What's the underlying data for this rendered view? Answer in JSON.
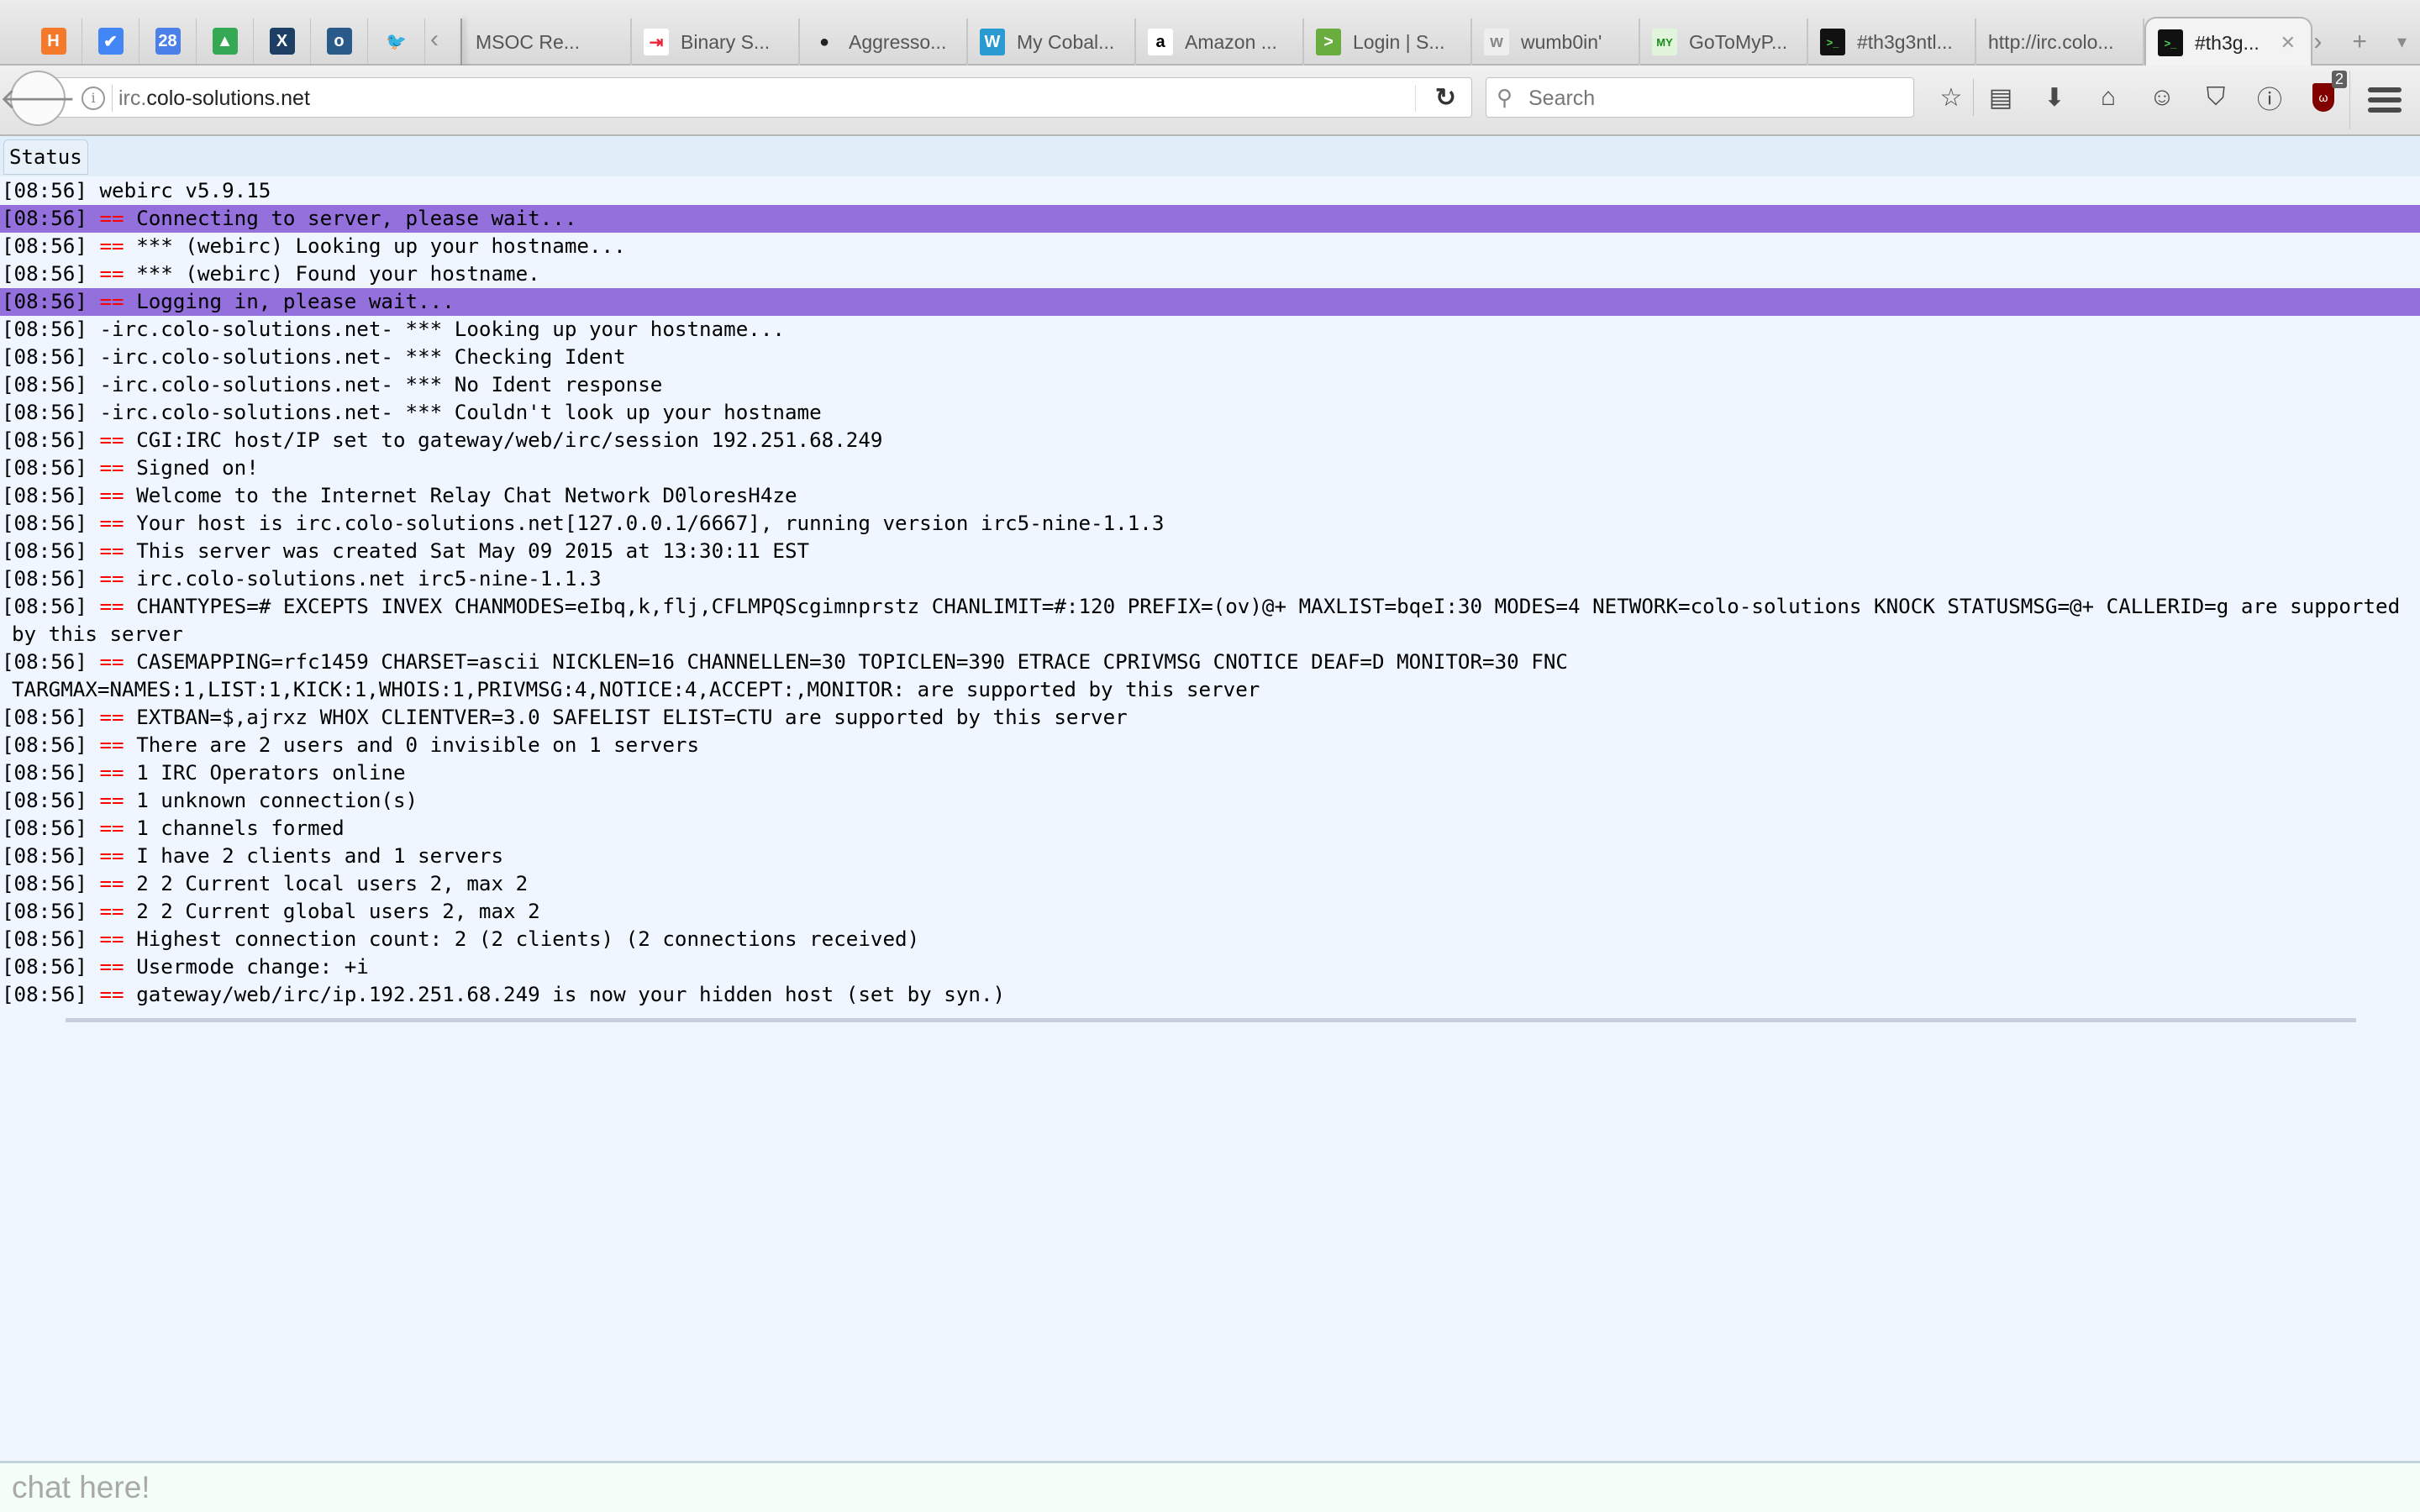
{
  "browser": {
    "pinned_tabs": [
      {
        "icon": "harvest-icon",
        "glyph": "H",
        "color": "#f5792a"
      },
      {
        "icon": "inbox-icon",
        "glyph": "✔",
        "color": "#4285f4"
      },
      {
        "icon": "google-calendar-icon",
        "glyph": "28",
        "color": "#4a80e8"
      },
      {
        "icon": "google-drive-icon",
        "glyph": "▲",
        "color": "#34a853"
      },
      {
        "icon": "jira-icon",
        "glyph": "X",
        "color": "#1d3f66"
      },
      {
        "icon": "trash-bucket-icon",
        "glyph": "o",
        "color": "#2a5a8a"
      },
      {
        "icon": "twitter-icon",
        "glyph": "🐦",
        "color": "#55acee"
      }
    ],
    "tabs": [
      {
        "label": "MSOC Re...",
        "icon": "none",
        "fav_glyph": "",
        "fav_bg": "transparent",
        "fav_color": "#000"
      },
      {
        "label": "Binary S...",
        "icon": "binary-icon",
        "fav_glyph": "⇥",
        "fav_bg": "#ffffff",
        "fav_color": "#e8253a"
      },
      {
        "label": "Aggresso...",
        "icon": "github-icon",
        "fav_glyph": "●",
        "fav_bg": "transparent",
        "fav_color": "#222"
      },
      {
        "label": "My Cobal...",
        "icon": "wordpress-icon",
        "fav_glyph": "W",
        "fav_bg": "#2a9ad3",
        "fav_color": "#fff"
      },
      {
        "label": "Amazon ...",
        "icon": "amazon-icon",
        "fav_glyph": "a",
        "fav_bg": "#ffffff",
        "fav_color": "#000"
      },
      {
        "label": "Login | S...",
        "icon": "login-terminal-icon",
        "fav_glyph": ">",
        "fav_bg": "#69ad3e",
        "fav_color": "#fff"
      },
      {
        "label": "wumb0in'",
        "icon": "keycap-icon",
        "fav_glyph": "w",
        "fav_bg": "#eeeeee",
        "fav_color": "#888"
      },
      {
        "label": "GoToMyP...",
        "icon": "gotomypc-icon",
        "fav_glyph": "MY",
        "fav_bg": "#e2f5dc",
        "fav_color": "#1a8c1a"
      },
      {
        "label": "#th3g3ntl...",
        "icon": "terminal-icon",
        "fav_glyph": ">_",
        "fav_bg": "#111",
        "fav_color": "#4ed24e"
      },
      {
        "label": "http://irc.colo...",
        "icon": "none",
        "fav_glyph": "",
        "fav_bg": "transparent",
        "fav_color": "#000"
      },
      {
        "label": "#th3g...",
        "icon": "terminal-icon",
        "fav_glyph": ">_",
        "fav_bg": "#111",
        "fav_color": "#4ed24e",
        "active": true
      }
    ],
    "tab_close_glyph": "✕",
    "scroll_right_glyph": "›",
    "new_tab_glyph": "+",
    "tab_list_glyph": "▾",
    "scroll_left_glyph": "‹",
    "url_dim": "irc.",
    "url_main": "colo-solutions.net",
    "search_placeholder": "Search",
    "addon_badge": "2"
  },
  "status_tab": "Status",
  "log": [
    {
      "ts": "[08:56]",
      "sep": "",
      "text": "webirc v5.9.15",
      "highlight": false
    },
    {
      "ts": "[08:56]",
      "sep": "==",
      "text": "Connecting to server, please wait...",
      "highlight": true
    },
    {
      "ts": "[08:56]",
      "sep": "==",
      "text": "*** (webirc) Looking up your hostname...",
      "highlight": false
    },
    {
      "ts": "[08:56]",
      "sep": "==",
      "text": "*** (webirc) Found your hostname.",
      "highlight": false
    },
    {
      "ts": "[08:56]",
      "sep": "==",
      "text": "Logging in, please wait...",
      "highlight": true
    },
    {
      "ts": "[08:56]",
      "sep": "",
      "text": "-irc.colo-solutions.net- *** Looking up your hostname...",
      "highlight": false
    },
    {
      "ts": "[08:56]",
      "sep": "",
      "text": "-irc.colo-solutions.net- *** Checking Ident",
      "highlight": false
    },
    {
      "ts": "[08:56]",
      "sep": "",
      "text": "-irc.colo-solutions.net- *** No Ident response",
      "highlight": false
    },
    {
      "ts": "[08:56]",
      "sep": "",
      "text": "-irc.colo-solutions.net- *** Couldn't look up your hostname",
      "highlight": false
    },
    {
      "ts": "[08:56]",
      "sep": "==",
      "text": "CGI:IRC host/IP set to gateway/web/irc/session 192.251.68.249",
      "highlight": false
    },
    {
      "ts": "[08:56]",
      "sep": "==",
      "text": "Signed on!",
      "highlight": false
    },
    {
      "ts": "[08:56]",
      "sep": "==",
      "text": "Welcome to the Internet Relay Chat Network D0loresH4ze",
      "highlight": false
    },
    {
      "ts": "[08:56]",
      "sep": "==",
      "text": "Your host is irc.colo-solutions.net[127.0.0.1/6667], running version irc5-nine-1.1.3",
      "highlight": false
    },
    {
      "ts": "[08:56]",
      "sep": "==",
      "text": "This server was created Sat May 09 2015 at 13:30:11 EST",
      "highlight": false
    },
    {
      "ts": "[08:56]",
      "sep": "==",
      "text": "irc.colo-solutions.net irc5-nine-1.1.3",
      "highlight": false
    },
    {
      "ts": "[08:56]",
      "sep": "==",
      "text": "CHANTYPES=# EXCEPTS INVEX CHANMODES=eIbq,k,flj,CFLMPQScgimnprstz CHANLIMIT=#:120 PREFIX=(ov)@+ MAXLIST=bqeI:30 MODES=4 NETWORK=colo-solutions KNOCK STATUSMSG=@+ CALLERID=g are supported by this server",
      "highlight": false
    },
    {
      "ts": "[08:56]",
      "sep": "==",
      "text": "CASEMAPPING=rfc1459 CHARSET=ascii NICKLEN=16 CHANNELLEN=30 TOPICLEN=390 ETRACE CPRIVMSG CNOTICE DEAF=D MONITOR=30 FNC TARGMAX=NAMES:1,LIST:1,KICK:1,WHOIS:1,PRIVMSG:4,NOTICE:4,ACCEPT:,MONITOR: are supported by this server",
      "highlight": false,
      "break_after": "FNC"
    },
    {
      "ts": "[08:56]",
      "sep": "==",
      "text": "EXTBAN=$,ajrxz WHOX CLIENTVER=3.0 SAFELIST ELIST=CTU are supported by this server",
      "highlight": false
    },
    {
      "ts": "[08:56]",
      "sep": "==",
      "text": "There are 2 users and 0 invisible on 1 servers",
      "highlight": false
    },
    {
      "ts": "[08:56]",
      "sep": "==",
      "text": "1 IRC Operators online",
      "highlight": false
    },
    {
      "ts": "[08:56]",
      "sep": "==",
      "text": "1 unknown connection(s)",
      "highlight": false
    },
    {
      "ts": "[08:56]",
      "sep": "==",
      "text": "1 channels formed",
      "highlight": false
    },
    {
      "ts": "[08:56]",
      "sep": "==",
      "text": "I have 2 clients and 1 servers",
      "highlight": false
    },
    {
      "ts": "[08:56]",
      "sep": "==",
      "text": "2 2 Current local users 2, max 2",
      "highlight": false
    },
    {
      "ts": "[08:56]",
      "sep": "==",
      "text": "2 2 Current global users 2, max 2",
      "highlight": false
    },
    {
      "ts": "[08:56]",
      "sep": "==",
      "text": "Highest connection count: 2 (2 clients) (2 connections received)",
      "highlight": false
    },
    {
      "ts": "[08:56]",
      "sep": "==",
      "text": "Usermode change: +i",
      "highlight": false
    },
    {
      "ts": "[08:56]",
      "sep": "==",
      "text": "gateway/web/irc/ip.192.251.68.249 is now your hidden host (set by syn.)",
      "highlight": false
    }
  ],
  "input": {
    "placeholder": "chat here!",
    "value": ""
  },
  "colors": {
    "highlight": "#9370db",
    "separator": "#ff0000",
    "background": "#eff6ff",
    "input_bg": "#f3fff6"
  }
}
